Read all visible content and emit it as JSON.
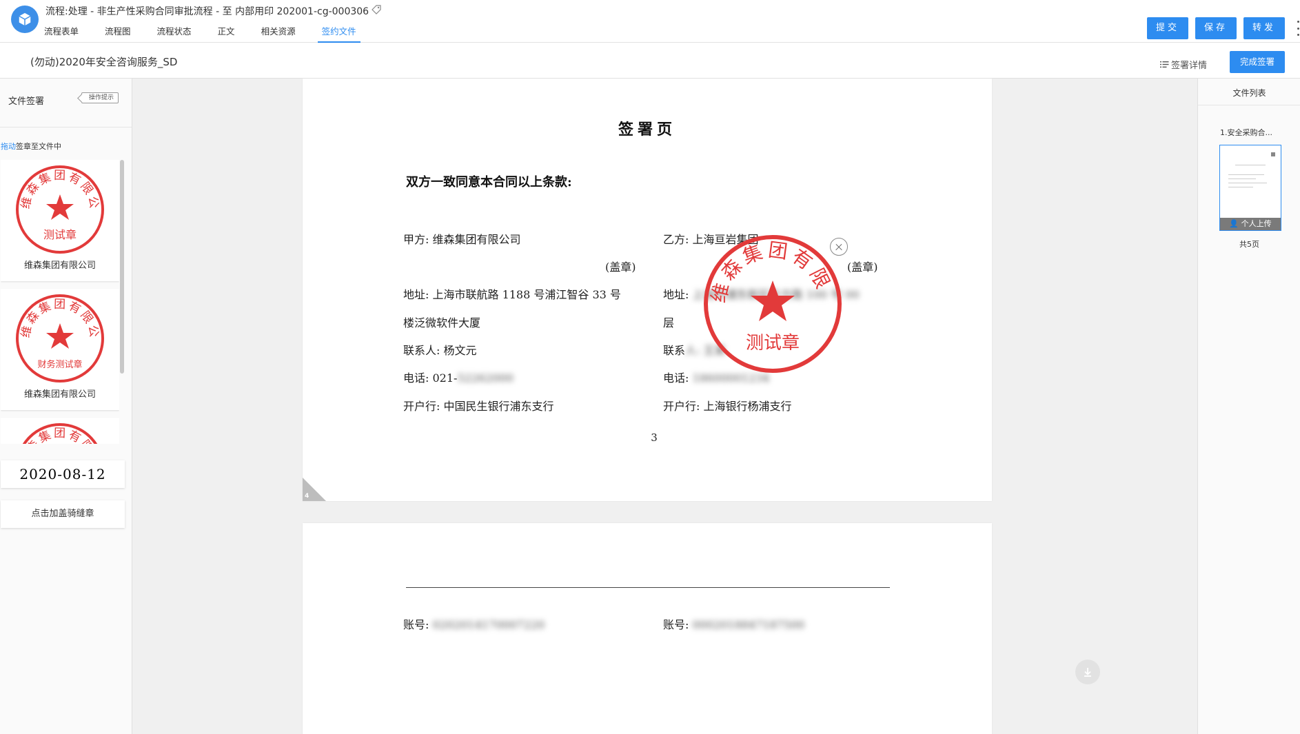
{
  "header": {
    "flow_title": "流程:处理 - 非生产性采购合同审批流程 - 至 内部用印 202001-cg-000306",
    "tabs": [
      {
        "label": "流程表单",
        "active": false
      },
      {
        "label": "流程图",
        "active": false
      },
      {
        "label": "流程状态",
        "active": false
      },
      {
        "label": "正文",
        "active": false
      },
      {
        "label": "相关资源",
        "active": false
      },
      {
        "label": "签约文件",
        "active": true
      }
    ],
    "buttons": {
      "submit": "提交",
      "save": "保存",
      "forward": "转发"
    }
  },
  "subheader": {
    "doc_title": "(勿动)2020年安全咨询服务_SD",
    "sign_detail": "签署详情",
    "finish": "完成签署"
  },
  "left_panel": {
    "title": "文件签署",
    "tip_badge": "操作提示",
    "drag_hint_highlight": "拖动",
    "drag_hint_rest": "签章至文件中",
    "seals": [
      {
        "company": "维森集团有限公司",
        "ring_text": "维森集团有限公司",
        "center_text": "测试章"
      },
      {
        "company": "维森集团有限公司",
        "ring_text": "维森集团有限公司",
        "center_text": "财务测试章"
      },
      {
        "company": "",
        "ring_text": "维森集团有限公司",
        "center_text": ""
      }
    ],
    "date": "2020-08-12",
    "ridge_button": "点击加盖骑缝章"
  },
  "document": {
    "heading": "签署页",
    "agree": "双方一致同意本合同以上条款:",
    "party_a": {
      "name": "甲方: 维森集团有限公司",
      "stamp": "(盖章)",
      "address_1": "地址: 上海市联航路 1188 号浦江智谷 33 号",
      "address_2": "楼泛微软件大厦",
      "contact": "联系人: 杨文元",
      "phone_label": "电话: 021-",
      "phone_blur": "52262000",
      "bank": "开户行: 中国民生银行浦东支行"
    },
    "party_b": {
      "name": "乙方: 上海亘岩集团",
      "stamp": "(盖章)",
      "address_label": "地址: ",
      "address_blur": "上海市浦东新区东方路 100 号 00",
      "address_2": "层",
      "contact_label": "联系",
      "contact_blur": "人: 王某",
      "phone_label": "电话: ",
      "phone_blur": "18600001234",
      "bank": "开户行: 上海银行杨浦支行"
    },
    "page_number": "3",
    "corner_number": "4",
    "placed_seal": {
      "ring_text": "维森集团有限公司",
      "center_text": "测试章"
    },
    "page2": {
      "account_a_label": "账号: ",
      "account_a_blur": "0202014170007220",
      "account_b_label": "账号: ",
      "account_b_blur": "0002018847187500"
    }
  },
  "right_panel": {
    "title": "文件列表",
    "file_name": "1.安全采购合...",
    "thumb_badge": "个人上传",
    "page_count": "共5页"
  },
  "colors": {
    "accent": "#2d8cf0",
    "seal_red": "#e23a3a"
  }
}
